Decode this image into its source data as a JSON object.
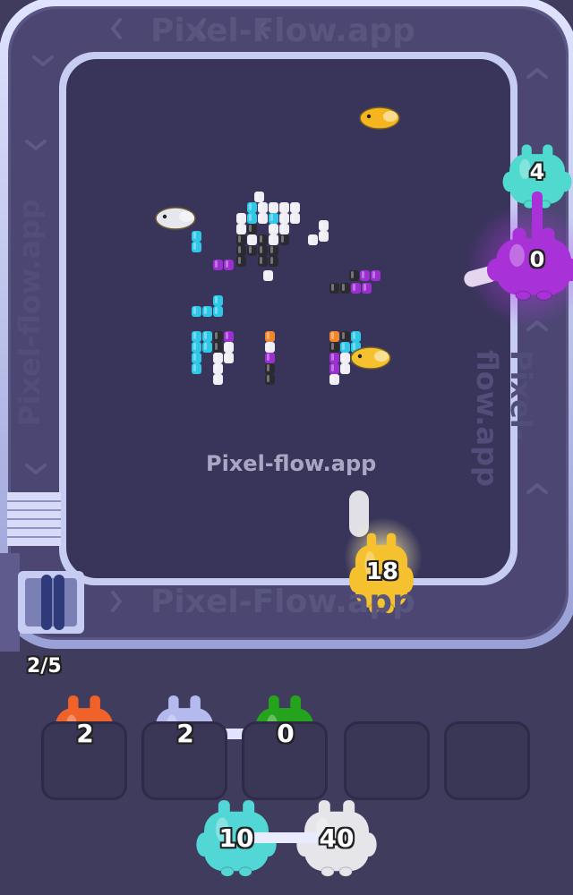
{
  "watermark": {
    "center_text": "Pixel-flow.app",
    "track_top_text": "Pixel-Flow.app",
    "track_bottom_text": "Pixel-Flow.app",
    "track_left_text": "Pixel-flow.app",
    "track_right_text": "Pixel-flow.app"
  },
  "progress": {
    "label": "2/5",
    "current": 2,
    "total": 5
  },
  "track_shooters": [
    {
      "id": "teal",
      "count": "4",
      "color": "#4fd9cf"
    },
    {
      "id": "purple",
      "count": "0",
      "color": "#a832d8"
    },
    {
      "id": "yellow",
      "count": "18",
      "color": "#f5c12e"
    }
  ],
  "queue_slots": [
    {
      "count": "2",
      "color": "#f0622a",
      "occupied": true
    },
    {
      "count": "2",
      "color": "#b4b9ee",
      "occupied": true
    },
    {
      "count": "0",
      "color": "#25a31c",
      "occupied": true
    },
    {
      "count": "",
      "color": "",
      "occupied": false
    },
    {
      "count": "",
      "color": "",
      "occupied": false
    }
  ],
  "next_pair": [
    {
      "count": "10",
      "color": "#53d6d6"
    },
    {
      "count": "40",
      "color": "#e6e6ea"
    }
  ],
  "colors": {
    "background": "#403c5e",
    "board": "#38345a",
    "track": "#c7cdf2",
    "cyan": "#2fc8e8",
    "black": "#2a2a30",
    "white": "#eeeef4",
    "purple": "#9b2fd0",
    "orange": "#f2862a"
  }
}
